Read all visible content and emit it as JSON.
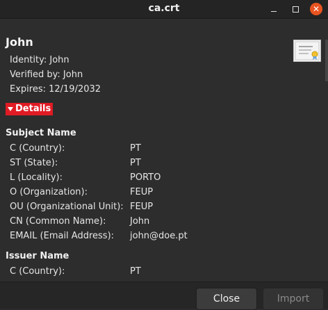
{
  "window": {
    "title": "ca.crt"
  },
  "cert": {
    "name": "John",
    "identity": "Identity: John",
    "verified_by": "Verified by: John",
    "expires": "Expires: 12/19/2032",
    "icon": "certificate-icon"
  },
  "details": {
    "label": "Details",
    "expanded": true
  },
  "subject": {
    "heading": "Subject Name",
    "rows": [
      {
        "label": "C (Country):",
        "value": "PT"
      },
      {
        "label": "ST (State):",
        "value": "PT"
      },
      {
        "label": "L (Locality):",
        "value": "PORTO"
      },
      {
        "label": "O (Organization):",
        "value": "FEUP"
      },
      {
        "label": "OU (Organizational Unit):",
        "value": "FEUP"
      },
      {
        "label": "CN (Common Name):",
        "value": "John"
      },
      {
        "label": "EMAIL (Email Address):",
        "value": "john@doe.pt"
      }
    ]
  },
  "issuer": {
    "heading": "Issuer Name",
    "rows": [
      {
        "label": "C (Country):",
        "value": "PT"
      }
    ]
  },
  "buttons": {
    "close": "Close",
    "import": "Import"
  },
  "colors": {
    "accent": "#e01b24",
    "window_close": "#e95420"
  }
}
